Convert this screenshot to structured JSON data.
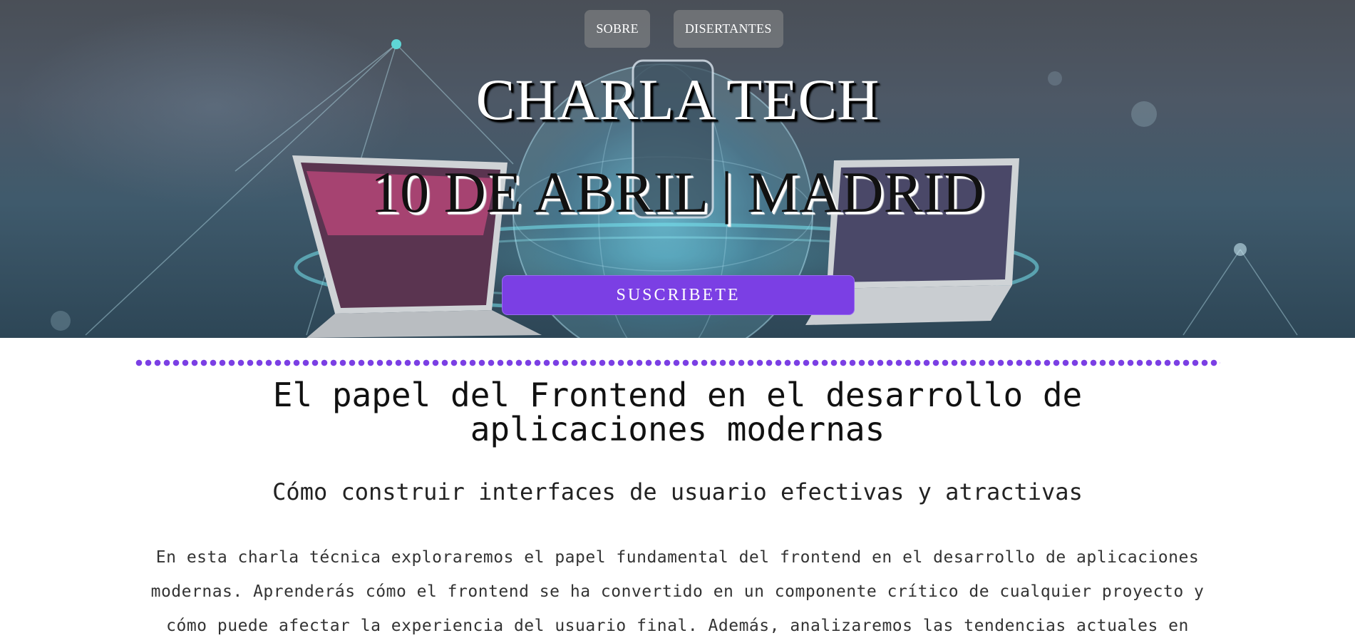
{
  "nav": {
    "items": [
      "SOBRE",
      "DISERTANTES"
    ]
  },
  "hero": {
    "title": "CHARLA TECH",
    "subtitle": "10 DE ABRIL | MADRID",
    "cta_label": "SUSCRIBETE"
  },
  "main": {
    "headline": "El papel del Frontend en el desarrollo de aplicaciones modernas",
    "tagline": "Cómo construir interfaces de usuario efectivas y atractivas",
    "body": "En esta charla técnica exploraremos el papel fundamental del frontend en el desarrollo de aplicaciones modernas. Aprenderás cómo el frontend se ha convertido en un componente crítico de cualquier proyecto y cómo puede afectar la experiencia del usuario final. Además, analizaremos las tendencias actuales en"
  },
  "colors": {
    "accent": "#7b3fe4",
    "nav_bg": "#8c8c8c",
    "hero_dark": "#4a4f57",
    "glow": "#78e6ff"
  },
  "icons": {
    "divider": "dotted-line"
  }
}
